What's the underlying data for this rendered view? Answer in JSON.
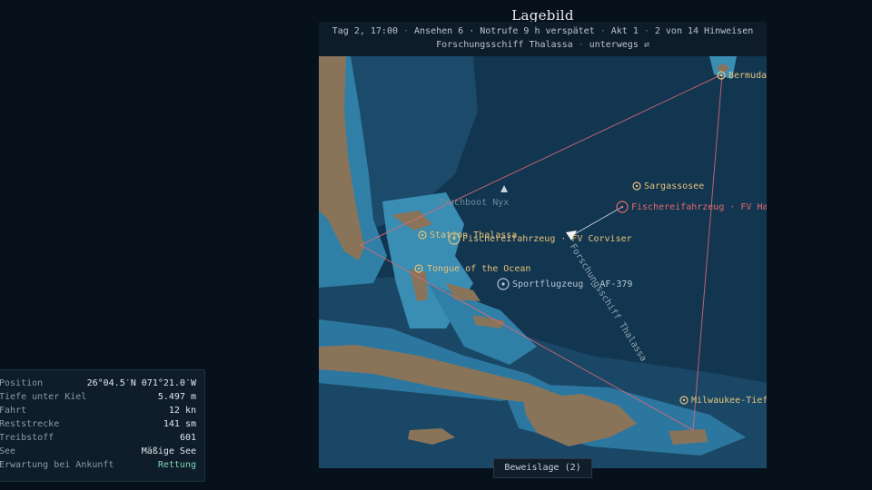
{
  "title": "Lagebild",
  "status": {
    "day_time": "Tag 2, 17:00",
    "views": "Ansehen 6 · Notrufe 9 h verspätet",
    "act": "Akt 1",
    "hints": "2 von 14 Hinweisen",
    "vessel": "Forschungsschiff Thalassa",
    "state": "unterwegs",
    "swap_icon": "⇄"
  },
  "markers": {
    "bermuda": "Bermuda-Seeberg",
    "sargasso": "Sargassosee",
    "halcyon": "Fischereifahrzeug · FV Halcyon",
    "corviser": "Fischereifahrzeug · FV Corviser",
    "station": "Station Thalassa",
    "tongue": "Tongue of the Ocean",
    "aircraft": "Sportflugzeug · AF-379",
    "milwaukee": "Milwaukee-Tief",
    "nyx": "Tauchboot Nyx",
    "ship_track": "Forschungsschiff Thalassa"
  },
  "panel": [
    {
      "key": "Position",
      "value": "26°04.5′N 071°21.0′W"
    },
    {
      "key": "Tiefe unter Kiel",
      "value": "5.497 m"
    },
    {
      "key": "Fahrt",
      "value": "12 kn"
    },
    {
      "key": "Reststrecke",
      "value": "141 sm"
    },
    {
      "key": "Treibstoff",
      "value": "601"
    },
    {
      "key": "See",
      "value": "Mäßige See"
    },
    {
      "key": "Erwartung bei Ankunft",
      "value": "Rettung"
    }
  ],
  "evidence_button": "Beweislage (2)",
  "colors": {
    "deep_sea": "#153a57",
    "shelf": "#2f7fa6",
    "land": "#8a7459",
    "triangle": "#d86a7a",
    "marker_gold": "#e5c27a",
    "marker_red": "#e56a6a"
  }
}
